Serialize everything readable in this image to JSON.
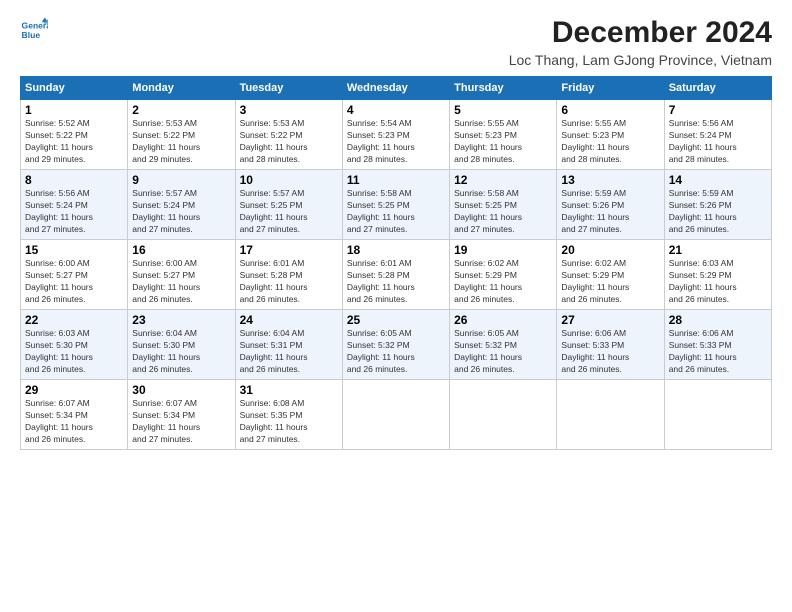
{
  "logo": {
    "line1": "General",
    "line2": "Blue"
  },
  "title": "December 2024",
  "subtitle": "Loc Thang, Lam GJong Province, Vietnam",
  "columns": [
    "Sunday",
    "Monday",
    "Tuesday",
    "Wednesday",
    "Thursday",
    "Friday",
    "Saturday"
  ],
  "weeks": [
    [
      {
        "day": "1",
        "info": "Sunrise: 5:52 AM\nSunset: 5:22 PM\nDaylight: 11 hours\nand 29 minutes."
      },
      {
        "day": "2",
        "info": "Sunrise: 5:53 AM\nSunset: 5:22 PM\nDaylight: 11 hours\nand 29 minutes."
      },
      {
        "day": "3",
        "info": "Sunrise: 5:53 AM\nSunset: 5:22 PM\nDaylight: 11 hours\nand 28 minutes."
      },
      {
        "day": "4",
        "info": "Sunrise: 5:54 AM\nSunset: 5:23 PM\nDaylight: 11 hours\nand 28 minutes."
      },
      {
        "day": "5",
        "info": "Sunrise: 5:55 AM\nSunset: 5:23 PM\nDaylight: 11 hours\nand 28 minutes."
      },
      {
        "day": "6",
        "info": "Sunrise: 5:55 AM\nSunset: 5:23 PM\nDaylight: 11 hours\nand 28 minutes."
      },
      {
        "day": "7",
        "info": "Sunrise: 5:56 AM\nSunset: 5:24 PM\nDaylight: 11 hours\nand 28 minutes."
      }
    ],
    [
      {
        "day": "8",
        "info": "Sunrise: 5:56 AM\nSunset: 5:24 PM\nDaylight: 11 hours\nand 27 minutes."
      },
      {
        "day": "9",
        "info": "Sunrise: 5:57 AM\nSunset: 5:24 PM\nDaylight: 11 hours\nand 27 minutes."
      },
      {
        "day": "10",
        "info": "Sunrise: 5:57 AM\nSunset: 5:25 PM\nDaylight: 11 hours\nand 27 minutes."
      },
      {
        "day": "11",
        "info": "Sunrise: 5:58 AM\nSunset: 5:25 PM\nDaylight: 11 hours\nand 27 minutes."
      },
      {
        "day": "12",
        "info": "Sunrise: 5:58 AM\nSunset: 5:25 PM\nDaylight: 11 hours\nand 27 minutes."
      },
      {
        "day": "13",
        "info": "Sunrise: 5:59 AM\nSunset: 5:26 PM\nDaylight: 11 hours\nand 27 minutes."
      },
      {
        "day": "14",
        "info": "Sunrise: 5:59 AM\nSunset: 5:26 PM\nDaylight: 11 hours\nand 26 minutes."
      }
    ],
    [
      {
        "day": "15",
        "info": "Sunrise: 6:00 AM\nSunset: 5:27 PM\nDaylight: 11 hours\nand 26 minutes."
      },
      {
        "day": "16",
        "info": "Sunrise: 6:00 AM\nSunset: 5:27 PM\nDaylight: 11 hours\nand 26 minutes."
      },
      {
        "day": "17",
        "info": "Sunrise: 6:01 AM\nSunset: 5:28 PM\nDaylight: 11 hours\nand 26 minutes."
      },
      {
        "day": "18",
        "info": "Sunrise: 6:01 AM\nSunset: 5:28 PM\nDaylight: 11 hours\nand 26 minutes."
      },
      {
        "day": "19",
        "info": "Sunrise: 6:02 AM\nSunset: 5:29 PM\nDaylight: 11 hours\nand 26 minutes."
      },
      {
        "day": "20",
        "info": "Sunrise: 6:02 AM\nSunset: 5:29 PM\nDaylight: 11 hours\nand 26 minutes."
      },
      {
        "day": "21",
        "info": "Sunrise: 6:03 AM\nSunset: 5:29 PM\nDaylight: 11 hours\nand 26 minutes."
      }
    ],
    [
      {
        "day": "22",
        "info": "Sunrise: 6:03 AM\nSunset: 5:30 PM\nDaylight: 11 hours\nand 26 minutes."
      },
      {
        "day": "23",
        "info": "Sunrise: 6:04 AM\nSunset: 5:30 PM\nDaylight: 11 hours\nand 26 minutes."
      },
      {
        "day": "24",
        "info": "Sunrise: 6:04 AM\nSunset: 5:31 PM\nDaylight: 11 hours\nand 26 minutes."
      },
      {
        "day": "25",
        "info": "Sunrise: 6:05 AM\nSunset: 5:32 PM\nDaylight: 11 hours\nand 26 minutes."
      },
      {
        "day": "26",
        "info": "Sunrise: 6:05 AM\nSunset: 5:32 PM\nDaylight: 11 hours\nand 26 minutes."
      },
      {
        "day": "27",
        "info": "Sunrise: 6:06 AM\nSunset: 5:33 PM\nDaylight: 11 hours\nand 26 minutes."
      },
      {
        "day": "28",
        "info": "Sunrise: 6:06 AM\nSunset: 5:33 PM\nDaylight: 11 hours\nand 26 minutes."
      }
    ],
    [
      {
        "day": "29",
        "info": "Sunrise: 6:07 AM\nSunset: 5:34 PM\nDaylight: 11 hours\nand 26 minutes."
      },
      {
        "day": "30",
        "info": "Sunrise: 6:07 AM\nSunset: 5:34 PM\nDaylight: 11 hours\nand 27 minutes."
      },
      {
        "day": "31",
        "info": "Sunrise: 6:08 AM\nSunset: 5:35 PM\nDaylight: 11 hours\nand 27 minutes."
      },
      {
        "day": "",
        "info": ""
      },
      {
        "day": "",
        "info": ""
      },
      {
        "day": "",
        "info": ""
      },
      {
        "day": "",
        "info": ""
      }
    ]
  ]
}
